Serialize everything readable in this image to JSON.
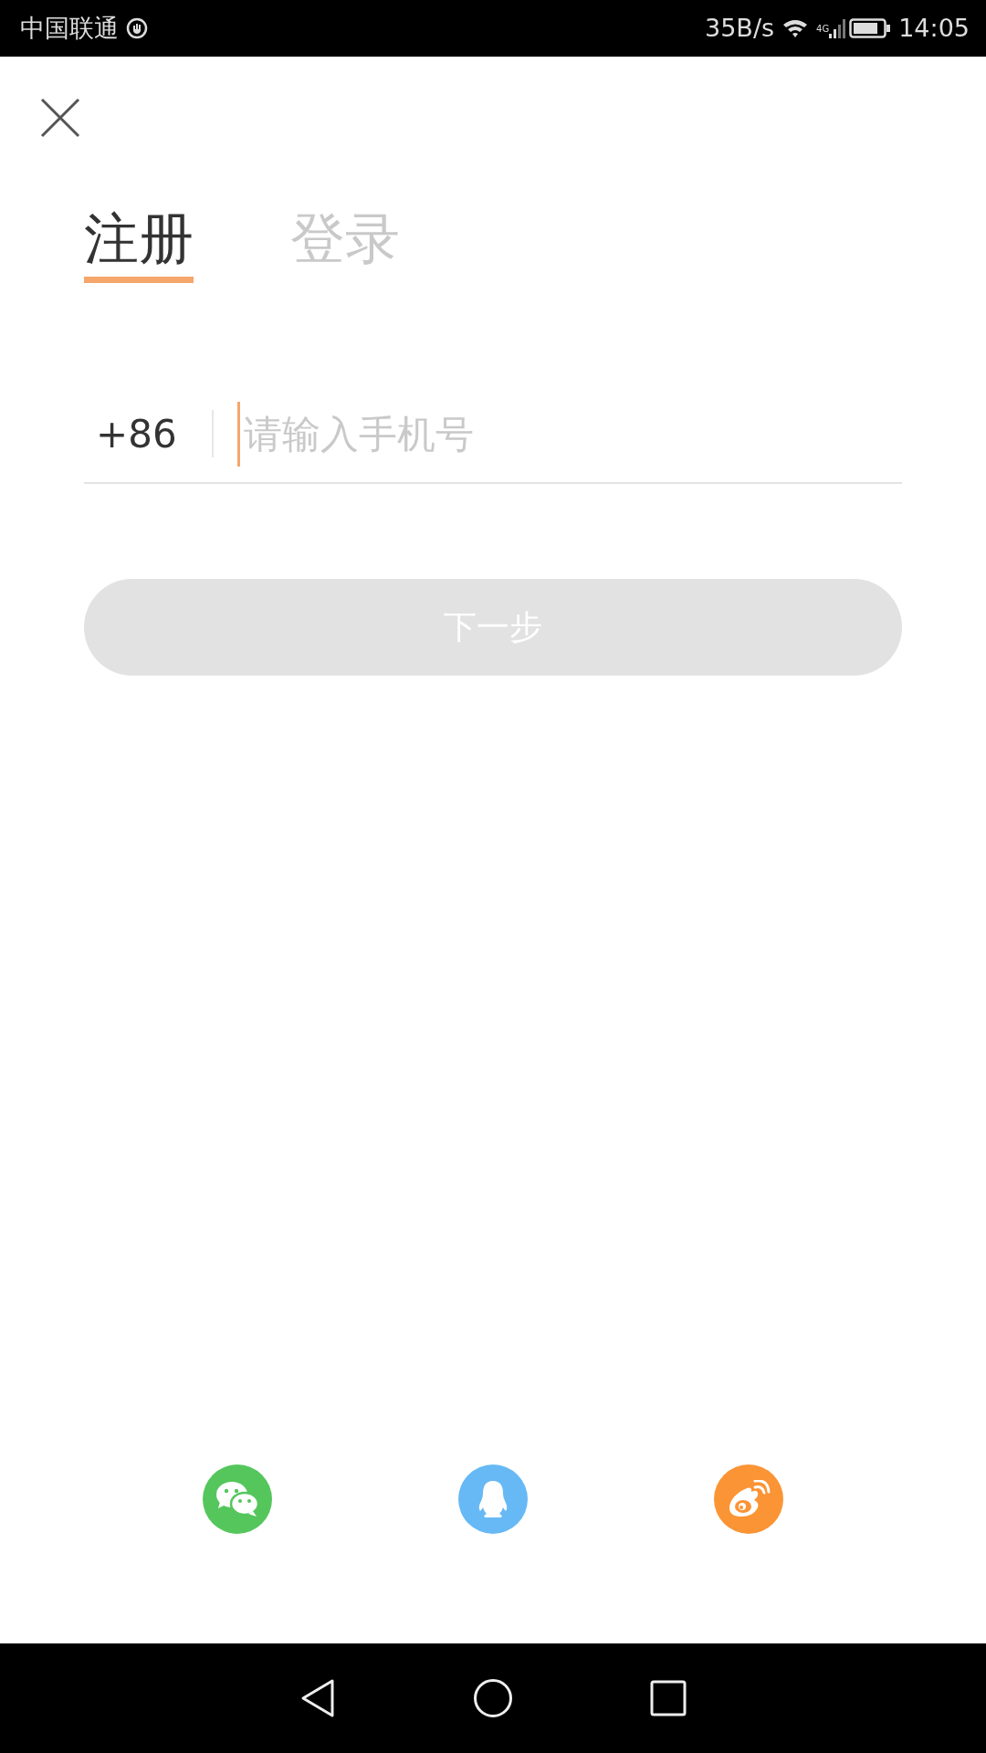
{
  "status_bar": {
    "carrier": "中国联通",
    "speed": "35B/s",
    "network": "4G",
    "time": "14:05"
  },
  "tabs": [
    {
      "label": "注册",
      "selected": true
    },
    {
      "label": "登录",
      "selected": false
    }
  ],
  "phone": {
    "country_code": "+86",
    "placeholder": "请输入手机号",
    "focused": true
  },
  "next_button": {
    "label": "下一步",
    "disabled": true
  },
  "social_logins": [
    {
      "kind": "wechat",
      "color": "#55c65c"
    },
    {
      "kind": "qq",
      "color": "#67b9f5"
    },
    {
      "kind": "weibo",
      "color": "#fb9435"
    }
  ]
}
